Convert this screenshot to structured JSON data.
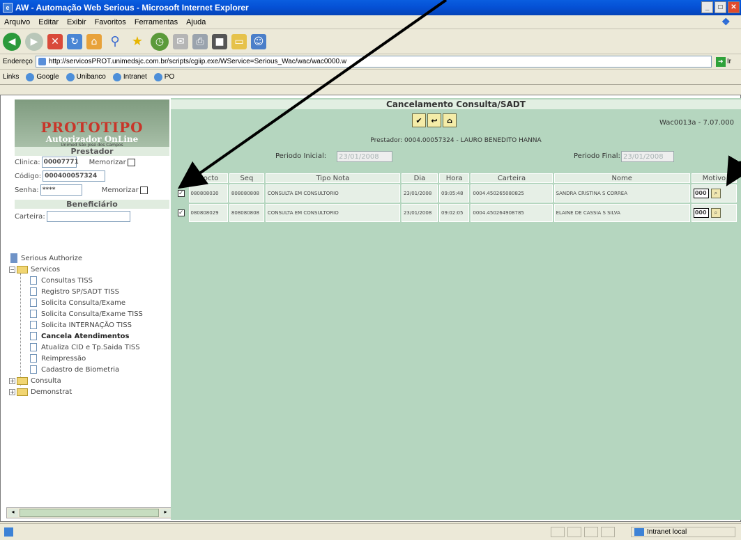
{
  "window": {
    "title": "AW - Automação Web Serious - Microsoft Internet Explorer"
  },
  "menu": [
    "Arquivo",
    "Editar",
    "Exibir",
    "Favoritos",
    "Ferramentas",
    "Ajuda"
  ],
  "address": {
    "label": "Endereço",
    "url": "http://servicosPROT.unimedsjc.com.br/scripts/cgiip.exe/WService=Serious_Wac/wac/wac0000.w",
    "go_label": "Ir"
  },
  "links": {
    "label": "Links",
    "items": [
      "Google",
      "Unibanco",
      "Intranet",
      "PO"
    ]
  },
  "logo": {
    "title": "PROTOTIPO",
    "subtitle": "Autorizador OnLine",
    "tagline": "Unimed São José dos Campos"
  },
  "prestador_panel": {
    "header": "Prestador",
    "clinica_label": "Clinica:",
    "clinica_value": "00007771",
    "memorizar_label": "Memorizar",
    "codigo_label": "Código:",
    "codigo_value": "000400057324",
    "senha_label": "Senha:",
    "senha_value": "****"
  },
  "beneficiario_panel": {
    "header": "Beneficiário",
    "carteira_label": "Carteira:"
  },
  "tree": {
    "root": "Serious Authorize",
    "servicos": "Servicos",
    "items": [
      "Consultas TISS",
      "Registro SP/SADT TISS",
      "Solicita Consulta/Exame",
      "Solicita Consulta/Exame TISS",
      "Solicita INTERNAÇÃO TISS",
      "Cancela Atendimentos",
      "Atualiza CID e Tp.Saida TISS",
      "Reimpressão",
      "Cadastro de Biometria"
    ],
    "consulta": "Consulta",
    "demonstrat": "Demonstrat"
  },
  "main": {
    "title": "Cancelamento Consulta/SADT",
    "version": "Wac0013a - 7.07.000",
    "prestador_line": "Prestador: 0004.00057324 - LAURO BENEDITO HANNA",
    "periodo_inicial_label": "Periodo Inicial:",
    "periodo_inicial_value": "23/01/2008",
    "periodo_final_label": "Periodo Final:",
    "periodo_final_value": "23/01/2008",
    "columns": [
      "Docto",
      "Seq",
      "Tipo Nota",
      "Dia",
      "Hora",
      "Carteira",
      "Nome",
      "Motivo"
    ],
    "rows": [
      {
        "checked": true,
        "docto": "080808030",
        "seq": "808080808",
        "tipo": "CONSULTA EM CONSULTORIO",
        "dia": "23/01/2008",
        "hora": "09:05:48",
        "carteira": "0004.450265080825",
        "nome": "SANDRA CRISTINA S CORREA",
        "motivo": "000"
      },
      {
        "checked": true,
        "docto": "080808029",
        "seq": "808080808",
        "tipo": "CONSULTA EM CONSULTORIO",
        "dia": "23/01/2008",
        "hora": "09:02:05",
        "carteira": "0004.450264908785",
        "nome": "ELAINE DE CASSIA S SILVA",
        "motivo": "000"
      }
    ]
  },
  "status": {
    "zone": "Intranet local"
  }
}
